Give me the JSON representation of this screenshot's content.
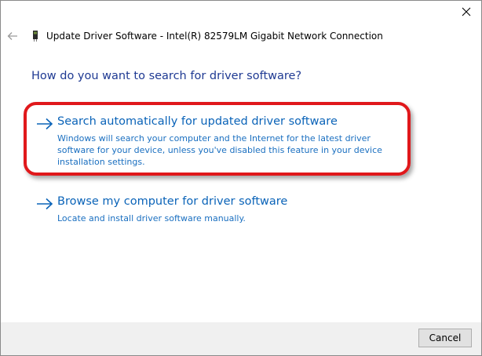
{
  "window": {
    "title": "Update Driver Software - Intel(R) 82579LM Gigabit Network Connection",
    "close_icon": "close-icon",
    "back_icon": "back-arrow-icon",
    "device_icon": "network-adapter-icon"
  },
  "main": {
    "heading": "How do you want to search for driver software?",
    "options": [
      {
        "title": "Search automatically for updated driver software",
        "description": "Windows will search your computer and the Internet for the latest driver software for your device, unless you've disabled this feature in your device installation settings.",
        "icon": "arrow-right-icon",
        "highlighted": true,
        "highlight_color": "#e0181b"
      },
      {
        "title": "Browse my computer for driver software",
        "description": "Locate and install driver software manually.",
        "icon": "arrow-right-icon",
        "highlighted": false
      }
    ]
  },
  "footer": {
    "cancel_label": "Cancel"
  },
  "colors": {
    "heading": "#1f3a93",
    "link": "#0a63b8",
    "footer_bg": "#f0f0f0"
  }
}
